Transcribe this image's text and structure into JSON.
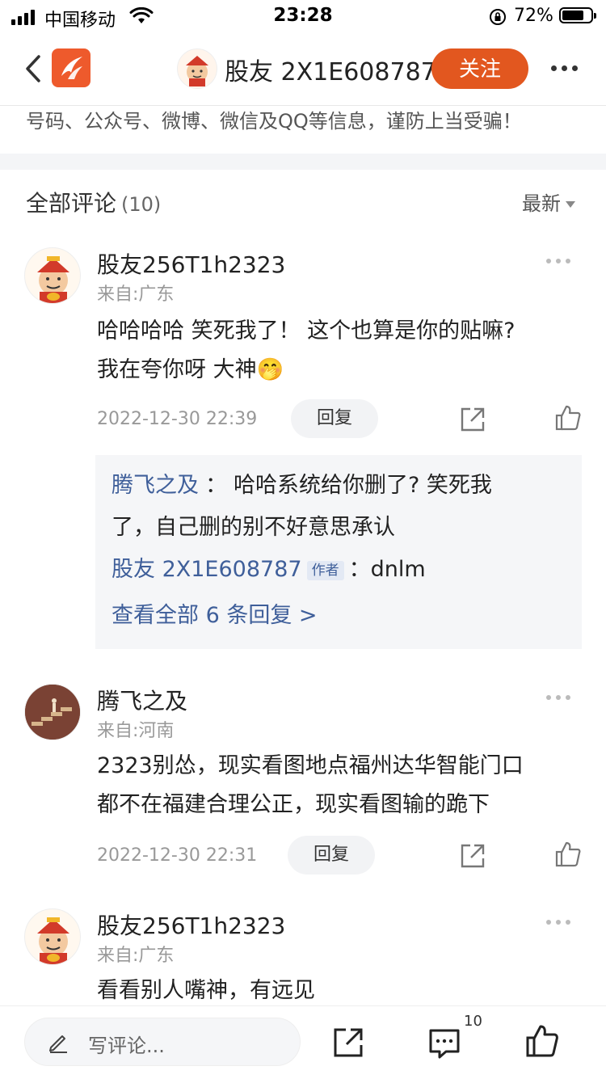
{
  "status_bar": {
    "carrier": "中国移动",
    "time": "23:28",
    "battery": "72%"
  },
  "nav": {
    "author_name": "股友 2X1E608787",
    "follow_label": "关注"
  },
  "warning_text": "号码、公众号、微博、微信及QQ等信息，谨防上当受骗！",
  "comments_header": {
    "title": "全部评论",
    "count": "(10)",
    "sort_label": "最新"
  },
  "comments": [
    {
      "username": "股友256T1h2323",
      "location": "来自:广东",
      "text_line1": "哈哈哈哈 笑死我了！ 这个也算是你的贴嘛?",
      "text_line2": "我在夸你呀 大神🤭",
      "time": "2022-12-30 22:39",
      "reply_label": "回复",
      "replies": {
        "r1_name": "腾飞之及",
        "r1_sep": "：",
        "r1_text_a": "哈哈系统给你删了? 笑死我",
        "r1_text_b": "了，自己删的别不好意思承认",
        "r2_name": "股友 2X1E608787",
        "r2_tag": "作者",
        "r2_sep": "：",
        "r2_text": "dnlm",
        "view_all": "查看全部 6 条回复 >"
      }
    },
    {
      "username": "腾飞之及",
      "location": "来自:河南",
      "text_line1": "2323别怂，现实看图地点福州达华智能门口",
      "text_line2": "都不在福建合理公正，现实看图输的跪下",
      "time": "2022-12-30 22:31",
      "reply_label": "回复"
    },
    {
      "username": "股友256T1h2323",
      "location": "来自:广东",
      "text_line1": "看看别人嘴神，有远见"
    }
  ],
  "bottom_bar": {
    "input_placeholder": "写评论...",
    "comment_count": "10"
  }
}
